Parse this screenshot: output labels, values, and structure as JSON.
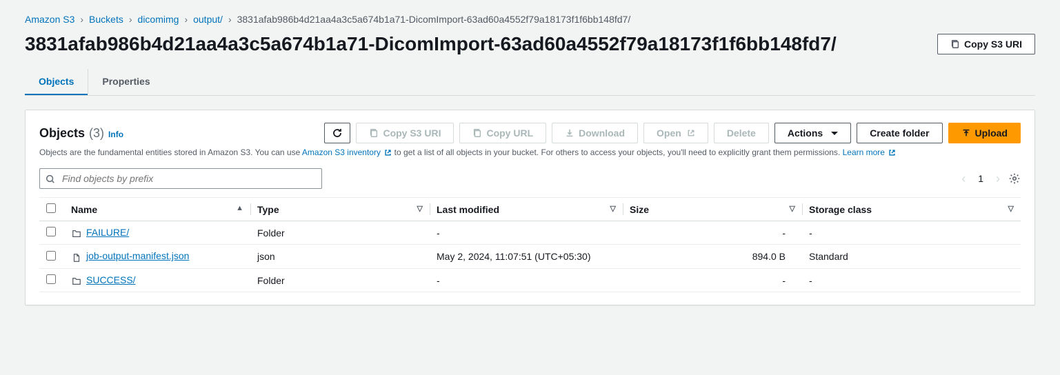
{
  "breadcrumb": {
    "items": [
      "Amazon S3",
      "Buckets",
      "dicomimg",
      "output/"
    ],
    "current": "3831afab986b4d21aa4a3c5a674b1a71-DicomImport-63ad60a4552f79a18173f1f6bb148fd7/"
  },
  "header": {
    "title": "3831afab986b4d21aa4a3c5a674b1a71-DicomImport-63ad60a4552f79a18173f1f6bb148fd7/",
    "copy_s3_uri": "Copy S3 URI"
  },
  "tabs": {
    "objects": "Objects",
    "properties": "Properties"
  },
  "panel": {
    "title": "Objects",
    "count": "(3)",
    "info": "Info",
    "desc_pre": "Objects are the fundamental entities stored in Amazon S3. You can use ",
    "inv_link": "Amazon S3 inventory",
    "desc_mid": " to get a list of all objects in your bucket. For others to access your objects, you'll need to explicitly grant them permissions. ",
    "learn_more": "Learn more",
    "search_placeholder": "Find objects by prefix",
    "page": "1"
  },
  "toolbar": {
    "copy_s3_uri": "Copy S3 URI",
    "copy_url": "Copy URL",
    "download": "Download",
    "open": "Open",
    "delete": "Delete",
    "actions": "Actions",
    "create_folder": "Create folder",
    "upload": "Upload"
  },
  "table": {
    "headers": {
      "name": "Name",
      "type": "Type",
      "modified": "Last modified",
      "size": "Size",
      "storage": "Storage class"
    },
    "rows": [
      {
        "name": "FAILURE/",
        "is_folder": true,
        "type": "Folder",
        "modified": "-",
        "size": "-",
        "storage": "-"
      },
      {
        "name": "job-output-manifest.json",
        "is_folder": false,
        "type": "json",
        "modified": "May 2, 2024, 11:07:51 (UTC+05:30)",
        "size": "894.0 B",
        "storage": "Standard"
      },
      {
        "name": "SUCCESS/",
        "is_folder": true,
        "type": "Folder",
        "modified": "-",
        "size": "-",
        "storage": "-"
      }
    ]
  }
}
